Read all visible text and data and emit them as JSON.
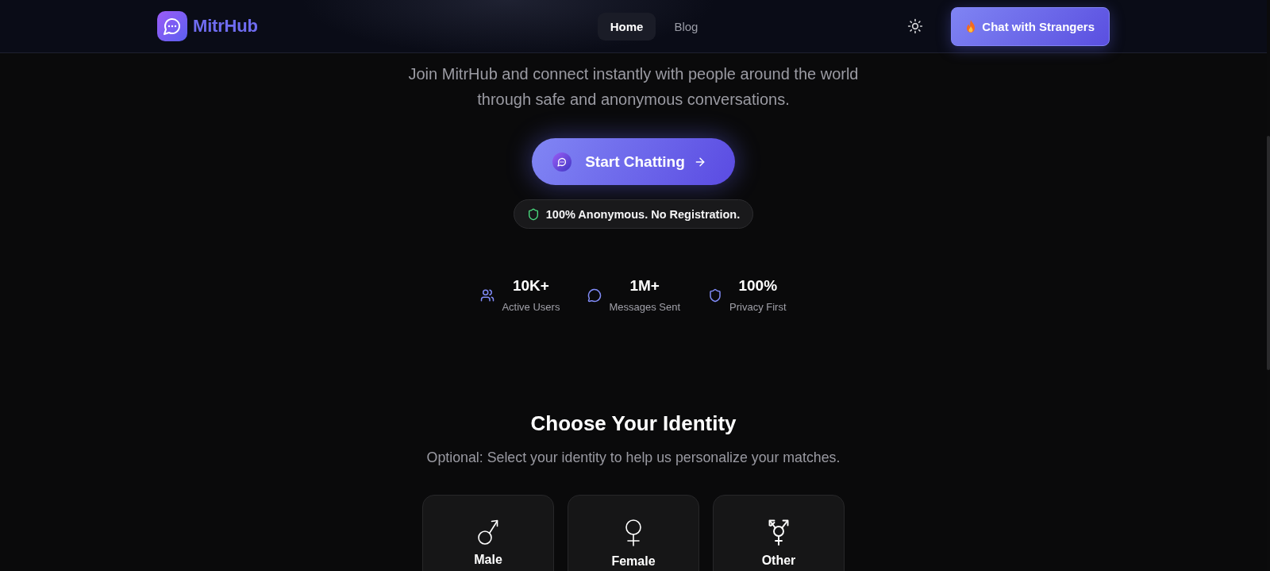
{
  "header": {
    "brand": "MitrHub",
    "nav": [
      {
        "label": "Home",
        "selected": true
      },
      {
        "label": "Blog",
        "selected": false
      }
    ],
    "cta_button": "Chat with Strangers"
  },
  "hero": {
    "description": "Join MitrHub and connect instantly with people around the world through safe and anonymous conversations.",
    "primary_button": "Start Chatting",
    "badge": "100% Anonymous. No Registration.",
    "stats": [
      {
        "kind": "users",
        "value": "10K+",
        "label": "Active Users"
      },
      {
        "kind": "messages",
        "value": "1M+",
        "label": "Messages Sent"
      },
      {
        "kind": "privacy",
        "value": "100%",
        "label": "Privacy First"
      }
    ]
  },
  "identity": {
    "title": "Choose Your Identity",
    "subtitle": "Optional: Select your identity to help us personalize your matches.",
    "options": [
      {
        "kind": "male",
        "label": "Male",
        "selected": false
      },
      {
        "kind": "female",
        "label": "Female",
        "selected": false
      },
      {
        "kind": "other",
        "label": "Other",
        "selected": false
      }
    ]
  }
}
